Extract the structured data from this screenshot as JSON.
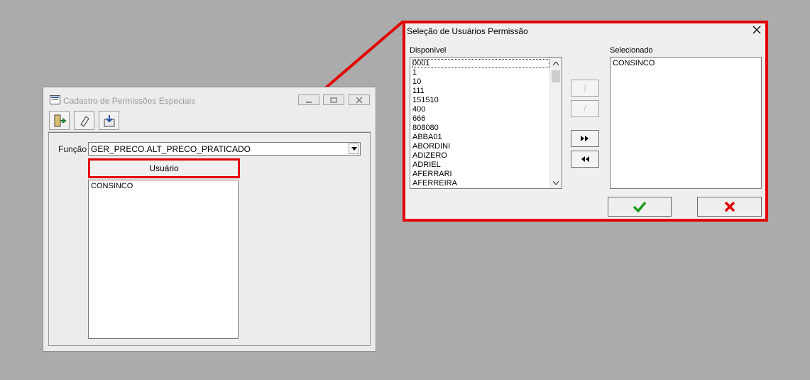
{
  "main_window": {
    "title": "Cadastro de Permissões Especiais",
    "funcao_label": "Função",
    "funcao_value": "GER_PRECO.ALT_PRECO_PRATICADO",
    "usuario_header": "Usuário",
    "usuario_items": [
      "CONSINCO"
    ],
    "toolbar_icons": [
      "exit-door-icon",
      "eraser-icon",
      "save-disk-icon"
    ]
  },
  "dialog": {
    "title": "Seleção de Usuários Permissão",
    "disponivel_label": "Disponível",
    "selecionado_label": "Selecionado",
    "disponivel_items": [
      "0001",
      "1",
      "10",
      "111",
      "151510",
      "400",
      "666",
      "808080",
      "ABBA01",
      "ABORDINI",
      "ADIZERO",
      "ADRIEL",
      "AFERRARI",
      "AFERREIRA"
    ],
    "selecionado_items": [
      "CONSINCO"
    ],
    "move_buttons": {
      "add_one": "|",
      "remove_one": "/",
      "add_all": "▶▶",
      "remove_all": "◀◀"
    }
  },
  "colors": {
    "highlight_red": "#e30000",
    "ok_green": "#1a9a1a",
    "cancel_red": "#e00000",
    "desktop": "#ababab"
  }
}
